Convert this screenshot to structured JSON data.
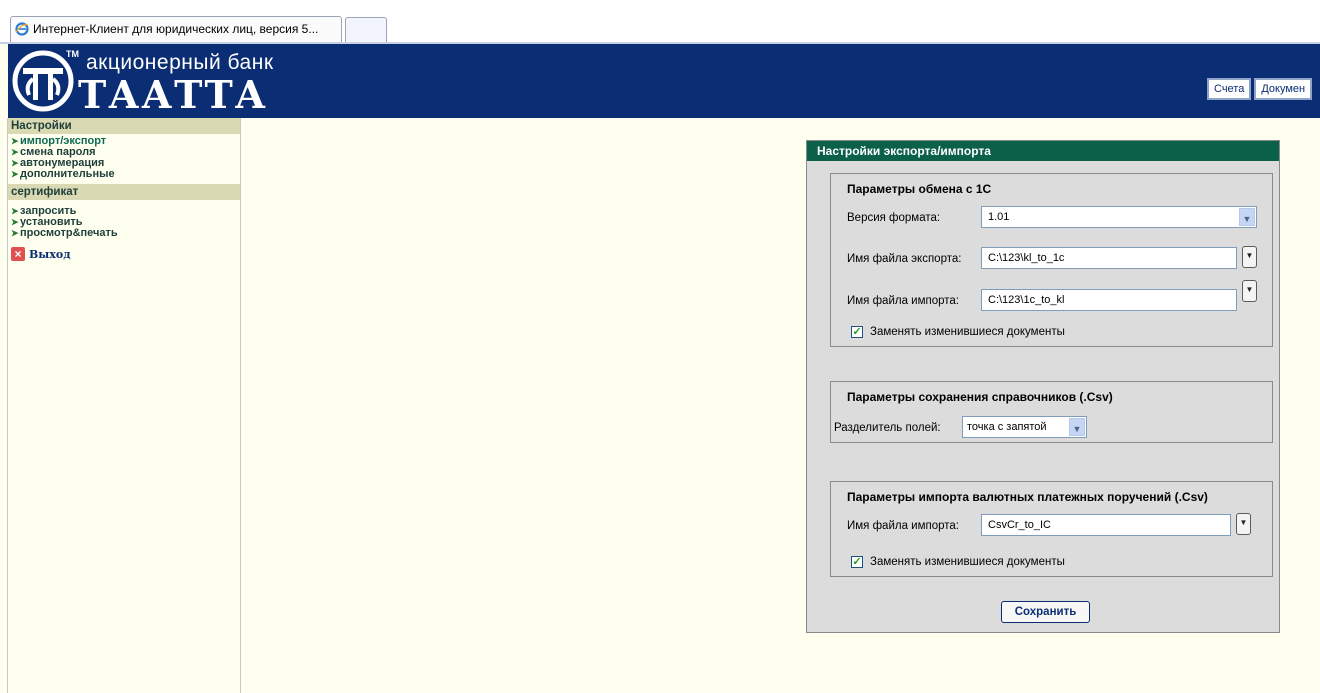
{
  "browser": {
    "tab_title": "Интернет-Клиент для юридических лиц, версия 5..."
  },
  "header": {
    "bank_subtitle": "акционерный банк",
    "bank_name": "ТААТТА",
    "tm": "TM",
    "nav": [
      "Счета",
      "Докумен"
    ]
  },
  "sidebar": {
    "settings_header": "Настройки",
    "settings_items": [
      "импорт/экспорт",
      "смена пароля",
      "автонумерация",
      "дополнительные"
    ],
    "cert_header": "сертификат",
    "cert_items": [
      "запросить",
      "установить",
      "просмотр&печать"
    ],
    "exit_label": "Выход"
  },
  "panel": {
    "title": "Настройки экспорта/импорта",
    "group1": {
      "title": "Параметры обмена с 1С",
      "format_label": "Версия формата:",
      "format_value": "1.01",
      "export_label": "Имя файла экспорта:",
      "export_value": "C:\\123\\kl_to_1c",
      "import_label": "Имя файла импорта:",
      "import_value": "C:\\123\\1c_to_kl",
      "replace_label": "Заменять изменившиеся документы"
    },
    "group2": {
      "title": "Параметры сохранения справочников (.Csv)",
      "delimiter_label": "Разделитель полей:",
      "delimiter_value": "точка с запятой"
    },
    "group3": {
      "title": "Параметры импорта валютных платежных поручений (.Csv)",
      "import_label": "Имя файла импорта:",
      "import_value": "CsvCr_to_IC",
      "replace_label": "Заменять изменившиеся документы"
    },
    "save_label": "Сохранить"
  },
  "colors": {
    "header_bg": "#0b2d74",
    "panel_title_bg": "#0b6049",
    "page_bg": "#fffff0",
    "sidebar_head_bg": "#d9d9b4"
  }
}
